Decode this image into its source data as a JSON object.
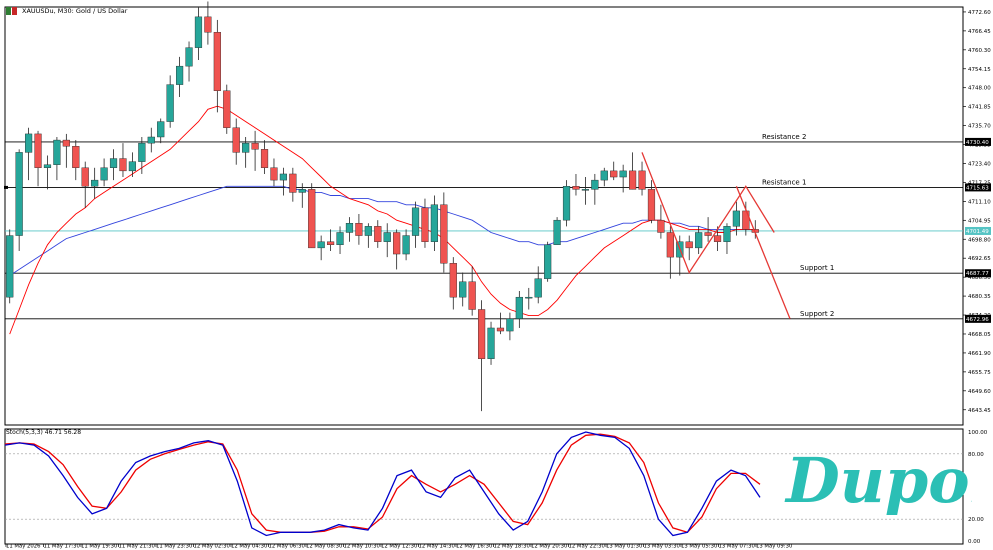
{
  "symbol_label": "XAUUSDu, M30:  Gold / US Dollar",
  "stoch_label": "Stoch(5,3,3) 46.71 56.28",
  "brand": "Dupoin",
  "colors": {
    "bull": "#26a69a",
    "bear": "#ef5350",
    "ma_fast": "#ff0000",
    "ma_slow": "#3344dd",
    "stoch_main": "#0000cc",
    "stoch_signal": "#ee0000",
    "hline": "#000000",
    "current_price_line": "#55c4c4",
    "pattern": "#e53935",
    "brand": "#2bbfb5",
    "frame": "#000000"
  },
  "levels": [
    {
      "name": "Resistance 2",
      "price": 4730.4,
      "price_label": "4730.40"
    },
    {
      "name": "Resistance 1",
      "price": 4715.63,
      "price_label": "4715.63"
    },
    {
      "name": "Support 1",
      "price": 4687.77,
      "price_label": "4687.77"
    },
    {
      "name": "Support 2",
      "price": 4672.96,
      "price_label": "4672.96"
    }
  ],
  "current_price": {
    "price": 4701.49,
    "label": "4701.49"
  },
  "chart_data": {
    "type": "candlestick",
    "title": "XAUUSDu, M30:  Gold / US Dollar",
    "y_ticks": [
      "4772.60",
      "4766.45",
      "4760.30",
      "4754.15",
      "4748.00",
      "4741.85",
      "4735.70",
      "4729.55",
      "4723.40",
      "4717.25",
      "4711.10",
      "4704.95",
      "4698.80",
      "4692.65",
      "4686.50",
      "4680.35",
      "4674.20",
      "4668.05",
      "4661.90",
      "4655.75",
      "4649.60",
      "4643.45"
    ],
    "ylim": [
      4638.5,
      4774.2
    ],
    "x_ticks": [
      "11 May 2026",
      "11 May 17:30",
      "11 May 19:30",
      "11 May 21:30",
      "11 May 23:30",
      "12 May 02:30",
      "12 May 04:30",
      "12 May 06:30",
      "12 May 08:30",
      "12 May 10:30",
      "12 May 12:30",
      "12 May 14:30",
      "12 May 16:30",
      "12 May 18:30",
      "12 May 20:30",
      "12 May 22:30",
      "13 May 01:30",
      "13 May 03:30",
      "13 May 05:30",
      "13 May 07:30",
      "13 May 09:30"
    ],
    "candles": [
      [
        4680,
        4702,
        4678,
        4700
      ],
      [
        4700,
        4728,
        4695,
        4727
      ],
      [
        4727,
        4735,
        4718,
        4733
      ],
      [
        4733,
        4734,
        4716,
        4722
      ],
      [
        4722,
        4726,
        4715,
        4723
      ],
      [
        4723,
        4732,
        4718,
        4731
      ],
      [
        4731,
        4733,
        4722,
        4729
      ],
      [
        4729,
        4731,
        4718,
        4722
      ],
      [
        4722,
        4724,
        4709,
        4716
      ],
      [
        4716,
        4722,
        4712,
        4718
      ],
      [
        4718,
        4725,
        4716,
        4722
      ],
      [
        4722,
        4728,
        4718,
        4725
      ],
      [
        4725,
        4730,
        4719,
        4721
      ],
      [
        4721,
        4727,
        4719,
        4724
      ],
      [
        4724,
        4732,
        4720,
        4730
      ],
      [
        4730,
        4735,
        4727,
        4732
      ],
      [
        4732,
        4738,
        4730,
        4737
      ],
      [
        4737,
        4752,
        4735,
        4749
      ],
      [
        4749,
        4758,
        4745,
        4755
      ],
      [
        4755,
        4763,
        4750,
        4761
      ],
      [
        4761,
        4774,
        4757,
        4771
      ],
      [
        4771,
        4776,
        4762,
        4766
      ],
      [
        4766,
        4770,
        4740,
        4747
      ],
      [
        4747,
        4749,
        4733,
        4735
      ],
      [
        4735,
        4738,
        4723,
        4727
      ],
      [
        4727,
        4732,
        4722,
        4730
      ],
      [
        4730,
        4734,
        4721,
        4728
      ],
      [
        4728,
        4731,
        4720,
        4722
      ],
      [
        4722,
        4725,
        4716,
        4718
      ],
      [
        4718,
        4722,
        4713,
        4720
      ],
      [
        4720,
        4722,
        4711,
        4714
      ],
      [
        4714,
        4717,
        4709,
        4715
      ],
      [
        4715,
        4717,
        4696,
        4696
      ],
      [
        4696,
        4700,
        4692,
        4698
      ],
      [
        4698,
        4702,
        4695,
        4697
      ],
      [
        4697,
        4703,
        4694,
        4701
      ],
      [
        4701,
        4706,
        4698,
        4704
      ],
      [
        4704,
        4707,
        4697,
        4700
      ],
      [
        4700,
        4704,
        4696,
        4703
      ],
      [
        4703,
        4705,
        4696,
        4698
      ],
      [
        4698,
        4704,
        4693,
        4701
      ],
      [
        4701,
        4702,
        4689,
        4694
      ],
      [
        4694,
        4702,
        4692,
        4700
      ],
      [
        4700,
        4711,
        4696,
        4709
      ],
      [
        4709,
        4712,
        4696,
        4698
      ],
      [
        4698,
        4713,
        4695,
        4710
      ],
      [
        4710,
        4714,
        4688,
        4691
      ],
      [
        4691,
        4693,
        4676,
        4680
      ],
      [
        4680,
        4688,
        4677,
        4685
      ],
      [
        4685,
        4690,
        4674,
        4676
      ],
      [
        4676,
        4679,
        4643,
        4660
      ],
      [
        4660,
        4672,
        4658,
        4670
      ],
      [
        4670,
        4675,
        4668,
        4669
      ],
      [
        4669,
        4675,
        4666,
        4673
      ],
      [
        4673,
        4682,
        4670,
        4680
      ],
      [
        4680,
        4683,
        4676,
        4680
      ],
      [
        4680,
        4690,
        4678,
        4686
      ],
      [
        4686,
        4698,
        4685,
        4697
      ],
      [
        4697,
        4706,
        4697,
        4705
      ],
      [
        4705,
        4718,
        4703,
        4716
      ],
      [
        4716,
        4720,
        4713,
        4715
      ],
      [
        4715,
        4719,
        4710,
        4715
      ],
      [
        4715,
        4720,
        4710,
        4718
      ],
      [
        4718,
        4722,
        4716,
        4721
      ],
      [
        4721,
        4724,
        4718,
        4719
      ],
      [
        4719,
        4723,
        4714,
        4721
      ],
      [
        4721,
        4727,
        4715,
        4715
      ],
      [
        4721,
        4724,
        4713,
        4715
      ],
      [
        4715,
        4718,
        4704,
        4705
      ],
      [
        4705,
        4710,
        4699,
        4701
      ],
      [
        4701,
        4703,
        4686,
        4693
      ],
      [
        4693,
        4700,
        4687,
        4698
      ],
      [
        4698,
        4700,
        4692,
        4696
      ],
      [
        4696,
        4703,
        4694,
        4701
      ],
      [
        4701,
        4706,
        4698,
        4700
      ],
      [
        4700,
        4703,
        4695,
        4698
      ],
      [
        4698,
        4704,
        4694,
        4703
      ],
      [
        4703,
        4711,
        4700,
        4708
      ],
      [
        4708,
        4711,
        4700,
        4702
      ],
      [
        4702,
        4705,
        4699,
        4701
      ]
    ],
    "ma_fast": [
      4668,
      4676,
      4684,
      4691,
      4697,
      4701,
      4704,
      4707,
      4709,
      4712,
      4714,
      4716,
      4718,
      4720,
      4722,
      4724,
      4726,
      4728,
      4731,
      4734,
      4737,
      4741,
      4742,
      4741,
      4739,
      4737,
      4735,
      4733,
      4731,
      4729,
      4727,
      4725,
      4722,
      4719,
      4716,
      4714,
      4712,
      4711,
      4710,
      4708,
      4707,
      4705,
      4704,
      4703,
      4702,
      4701,
      4699,
      4696,
      4693,
      4690,
      4685,
      4681,
      4678,
      4676,
      4675,
      4674,
      4674,
      4676,
      4679,
      4683,
      4687,
      4690,
      4693,
      4696,
      4698,
      4700,
      4702,
      4704,
      4705,
      4705,
      4704,
      4703,
      4702,
      4702,
      4702,
      4701,
      4701,
      4702,
      4702,
      4702
    ],
    "ma_slow": [
      4687,
      4689,
      4691,
      4693,
      4695,
      4697,
      4699,
      4700,
      4701,
      4702,
      4703,
      4704,
      4705,
      4706,
      4707,
      4708,
      4709,
      4710,
      4711,
      4712,
      4713,
      4714,
      4715,
      4716,
      4716,
      4716,
      4716,
      4716,
      4716,
      4716,
      4715,
      4715,
      4714,
      4714,
      4713,
      4713,
      4712,
      4712,
      4712,
      4711,
      4711,
      4711,
      4710,
      4710,
      4709,
      4709,
      4708,
      4707,
      4706,
      4705,
      4703,
      4701,
      4700,
      4699,
      4698,
      4698,
      4697,
      4697,
      4698,
      4698,
      4699,
      4700,
      4701,
      4702,
      4703,
      4704,
      4704,
      4705,
      4705,
      4705,
      4704,
      4704,
      4703,
      4703,
      4702,
      4702,
      4702,
      4702,
      4702,
      4702
    ],
    "pattern_zigzag": [
      [
        67,
        4727
      ],
      [
        72,
        4688
      ],
      [
        78,
        4716
      ],
      [
        81,
        4701
      ]
    ],
    "projection": {
      "from": [
        81,
        4716
      ],
      "to": [
        83,
        4673
      ]
    },
    "stochastic": {
      "yticks": [
        "100.00",
        "80.00",
        "20.00",
        "0.00"
      ],
      "main": [
        88,
        90,
        88,
        78,
        60,
        40,
        25,
        30,
        55,
        72,
        78,
        82,
        85,
        90,
        92,
        88,
        55,
        12,
        5,
        8,
        8,
        8,
        10,
        15,
        12,
        10,
        30,
        60,
        65,
        45,
        40,
        58,
        65,
        45,
        25,
        10,
        18,
        45,
        80,
        95,
        100,
        97,
        95,
        85,
        60,
        20,
        5,
        8,
        30,
        55,
        65,
        60,
        40
      ],
      "signal": [
        89,
        90,
        89,
        82,
        70,
        50,
        32,
        30,
        45,
        65,
        75,
        80,
        84,
        88,
        91,
        89,
        65,
        25,
        10,
        8,
        8,
        8,
        9,
        13,
        13,
        11,
        22,
        48,
        60,
        52,
        45,
        52,
        60,
        52,
        35,
        18,
        15,
        35,
        65,
        88,
        97,
        98,
        96,
        90,
        72,
        35,
        12,
        8,
        22,
        48,
        62,
        62,
        52
      ]
    }
  }
}
